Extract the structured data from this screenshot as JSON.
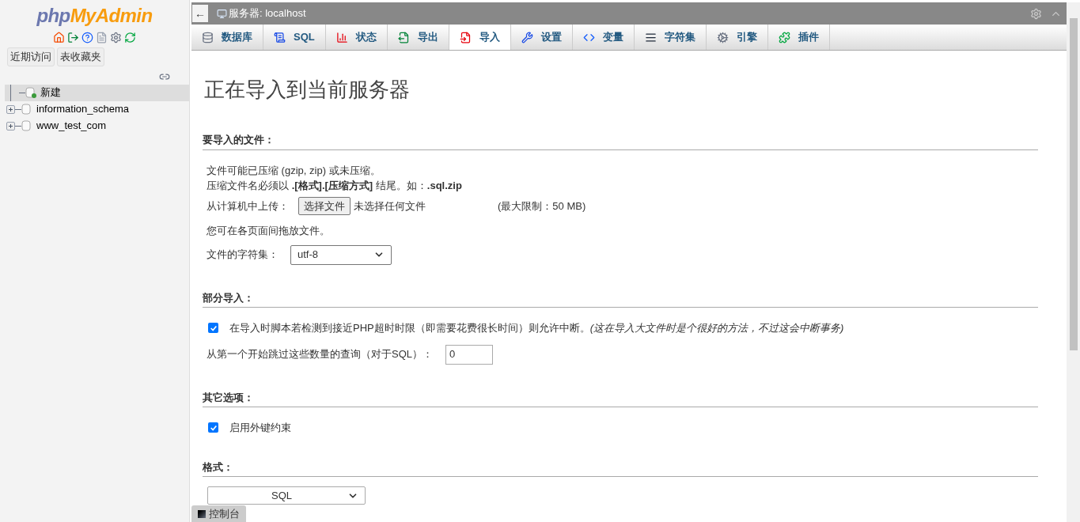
{
  "logo": {
    "part1": "php",
    "part2": "MyAdmin"
  },
  "sidebar_buttons": [
    "近期访问",
    "表收藏夹"
  ],
  "tree": [
    {
      "label": "新建",
      "kind": "new",
      "selected": true
    },
    {
      "label": "information_schema",
      "kind": "db",
      "selected": false,
      "expanded": false
    },
    {
      "label": "www_test_com",
      "kind": "db",
      "selected": false,
      "expanded": false
    }
  ],
  "server_bar": {
    "collapse": "←",
    "title": "服务器: localhost"
  },
  "tabs": [
    {
      "label": "数据库",
      "kind": "db",
      "selected": false
    },
    {
      "label": "SQL",
      "kind": "sql",
      "selected": false
    },
    {
      "label": "状态",
      "kind": "status",
      "selected": false
    },
    {
      "label": "导出",
      "kind": "export",
      "selected": false
    },
    {
      "label": "导入",
      "kind": "import",
      "selected": true
    },
    {
      "label": "设置",
      "kind": "settings",
      "selected": false
    },
    {
      "label": "变量",
      "kind": "vars",
      "selected": false
    },
    {
      "label": "字符集",
      "kind": "charset",
      "selected": false
    },
    {
      "label": "引擎",
      "kind": "engine",
      "selected": false
    },
    {
      "label": "插件",
      "kind": "plugin",
      "selected": false
    }
  ],
  "page_title": "正在导入到当前服务器",
  "file_section": {
    "heading": "要导入的文件：",
    "note1": "文件可能已压缩 (gzip, zip) 或未压缩。",
    "note2": "压缩文件名必须以 **.[格式].[压缩方式]** 结尾。如：**.sql.zip**",
    "upload_label": "从计算机中上传：",
    "choose_button": "选择文件",
    "no_file": "未选择任何文件",
    "max_size": "(最大限制：50 MB)",
    "drag_note": "您可在各页面间拖放文件。",
    "charset_label": "文件的字符集：",
    "charset_value": "utf-8"
  },
  "partial_section": {
    "heading": "部分导入：",
    "allow_interrupt": {
      "checked": true,
      "label": "在导入时脚本若检测到接近PHP超时时限（即需要花费很长时间）则允许中断。*(这在导入大文件时是个很好的方法，不过这会中断事务)*"
    },
    "skip_label": "从第一个开始跳过这些数量的查询（对于SQL）：",
    "skip_value": "0"
  },
  "other_section": {
    "heading": "其它选项：",
    "foreign_keys": {
      "checked": true,
      "label": "启用外键约束"
    }
  },
  "format_section": {
    "heading": "格式：",
    "format_value": "SQL"
  },
  "console": {
    "label": "控制台"
  }
}
